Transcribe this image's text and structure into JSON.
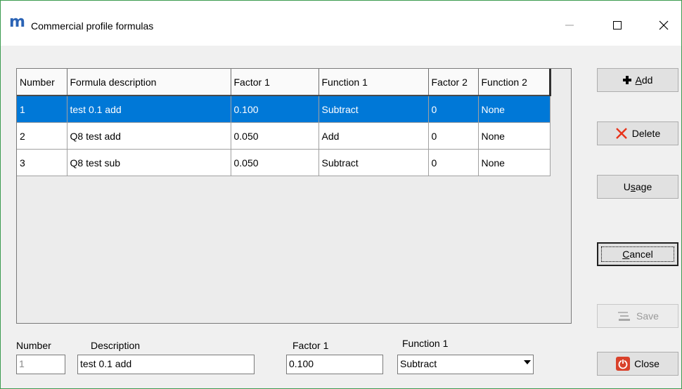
{
  "window": {
    "logo": "m",
    "title": "Commercial profile formulas",
    "icons": {
      "minimize": "minimize-icon",
      "maximize": "maximize-icon",
      "close": "close-icon"
    }
  },
  "grid": {
    "columns": [
      "Number",
      "Formula description",
      "Factor 1",
      "Function 1",
      "Factor 2",
      "Function 2"
    ],
    "rows": [
      [
        "1",
        "test 0.1 add",
        "0.100",
        "Subtract",
        "0",
        "None"
      ],
      [
        "2",
        "Q8 test add",
        "0.050",
        "Add",
        "0",
        "None"
      ],
      [
        "3",
        "Q8 test sub",
        "0.050",
        "Subtract",
        "0",
        "None"
      ]
    ],
    "selected_row": 0
  },
  "buttons": {
    "add": {
      "label_pre": "",
      "accel": "A",
      "label_post": "dd",
      "icon": "plus-icon"
    },
    "delete": {
      "label": "Delete",
      "icon": "delete-x-icon"
    },
    "usage": {
      "label_pre": "U",
      "accel": "s",
      "label_post": "age"
    },
    "cancel": {
      "label_pre": "",
      "accel": "C",
      "label_post": "ancel"
    },
    "save": {
      "label": "Save",
      "icon": "save-icon",
      "enabled": false
    },
    "close": {
      "label": "Close",
      "icon": "power-icon"
    }
  },
  "form": {
    "number_label": "Number",
    "number_value": "1",
    "description_label": "Description",
    "description_value": "test 0.1 add",
    "factor1_label": "Factor 1",
    "factor1_value": "0.100",
    "function1_label": "Function 1",
    "function1_value": "Subtract"
  },
  "colors": {
    "selection": "#0078d7",
    "window_border": "#3c9b50",
    "logo": "#2a63b5",
    "delete_icon": "#e8341c",
    "close_icon": "#d9412b"
  }
}
